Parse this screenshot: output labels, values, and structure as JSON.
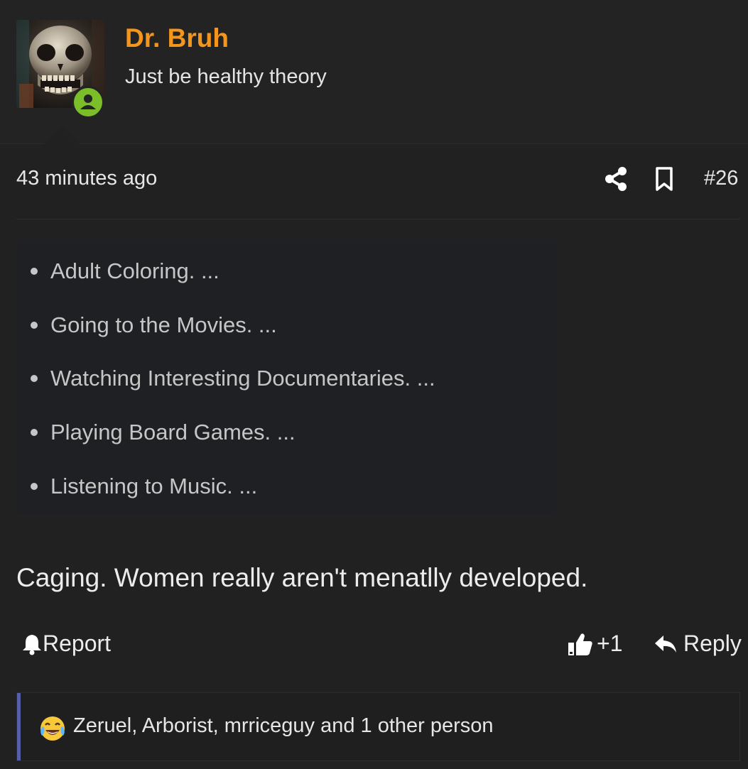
{
  "post": {
    "author": {
      "name": "Dr. Bruh",
      "tagline": "Just be healthy theory",
      "status_color": "#7cbd2a",
      "name_color": "#f4961b"
    },
    "timestamp": "43 minutes ago",
    "post_number": "#26",
    "quote_items": [
      "Adult Coloring. ...",
      "Going to the Movies. ...",
      "Watching Interesting Documentaries. ...",
      "Playing Board Games. ...",
      "Listening to Music. ..."
    ],
    "body": "Caging. Women really aren't menatlly developed.",
    "actions": {
      "report": "Report",
      "like": "+1",
      "reply": "Reply"
    },
    "reactions": {
      "emoji": "crying-laughing-emoji",
      "text": "Zeruel, Arborist, mrriceguy and 1 other person"
    },
    "icons": {
      "share": "share-icon",
      "bookmark": "bookmark-icon",
      "report": "bell-icon",
      "like": "thumbs-up-icon",
      "reply": "reply-arrow-icon"
    },
    "colors": {
      "background": "#212121",
      "reaction_accent": "#5660a8"
    }
  }
}
